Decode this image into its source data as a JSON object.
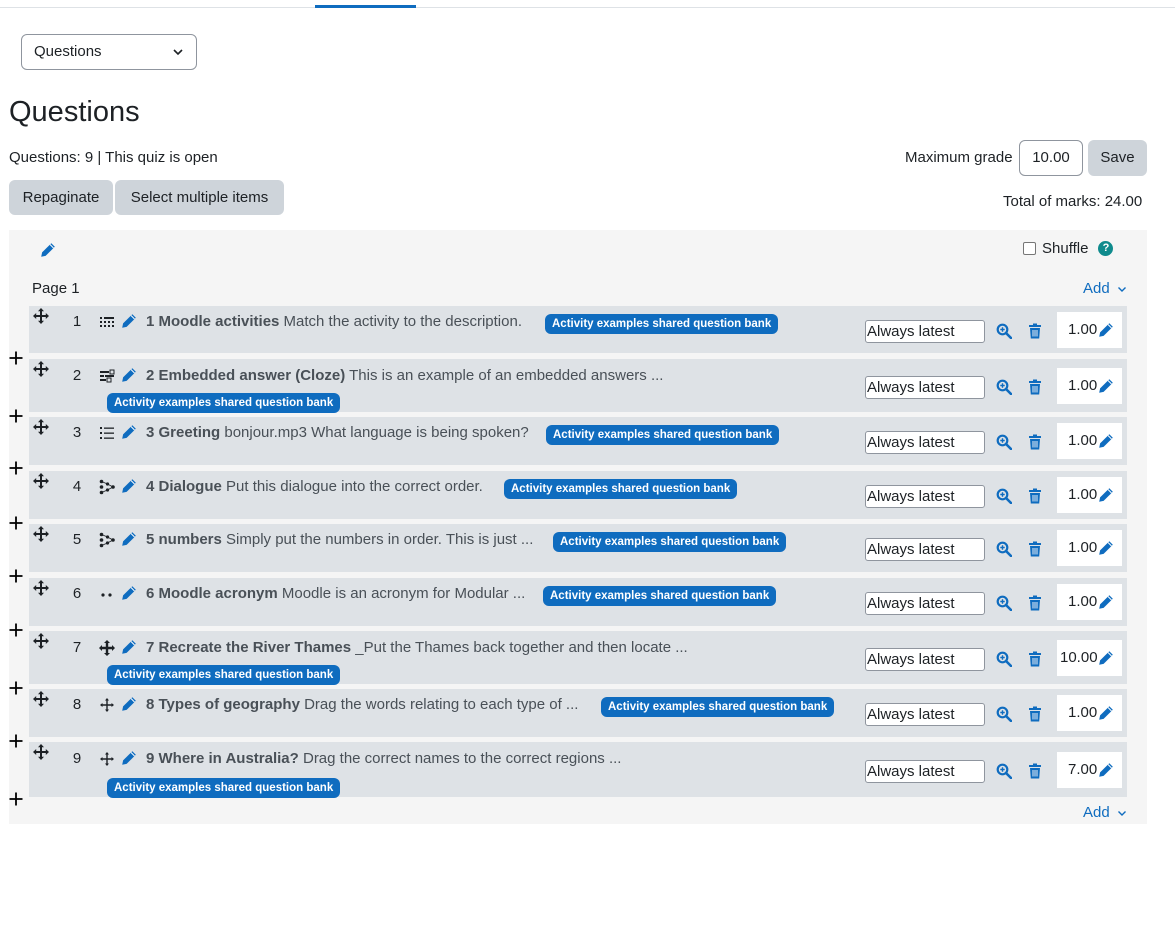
{
  "nav": {
    "selected": "Questions"
  },
  "title": "Questions",
  "info": "Questions: 9 | This quiz is open",
  "max_grade": {
    "label": "Maximum grade",
    "value": "10.00",
    "save_label": "Save"
  },
  "toolbar": {
    "repaginate_label": "Repaginate",
    "select_multiple_label": "Select multiple items"
  },
  "total_marks": "Total of marks: 24.00",
  "section": {
    "shuffle_label": "Shuffle",
    "help": "?",
    "page_label": "Page 1",
    "add_label": "Add"
  },
  "colors": {
    "accent": "#0f6cbf",
    "slot_bg": "#dee2e6",
    "button_grey": "#ced4da",
    "help_teal": "#0f8b8d"
  },
  "questions": [
    {
      "num": "1",
      "icon": "match-icon",
      "name": "1 Moodle activities",
      "text": "Match the activity to the description.",
      "bank": "Activity examples shared question bank",
      "version": "Always latest",
      "mark": "1.00"
    },
    {
      "num": "2",
      "icon": "cloze-icon",
      "name": "2 Embedded answer (Cloze)",
      "text": "This is an example of an embedded answers ...",
      "bank": "Activity examples shared question bank",
      "version": "Always latest",
      "mark": "1.00"
    },
    {
      "num": "3",
      "icon": "multichoice-icon",
      "name": "3 Greeting",
      "text": "bonjour.mp3 What language is being spoken?",
      "bank": "Activity examples shared question bank",
      "version": "Always latest",
      "mark": "1.00"
    },
    {
      "num": "4",
      "icon": "ordering-icon",
      "name": "4 Dialogue",
      "text": "Put this dialogue into the correct order.",
      "bank": "Activity examples shared question bank",
      "version": "Always latest",
      "mark": "1.00"
    },
    {
      "num": "5",
      "icon": "ordering-icon",
      "name": "5 numbers",
      "text": "Simply put the numbers in order. This is just ...",
      "bank": "Activity examples shared question bank",
      "version": "Always latest",
      "mark": "1.00"
    },
    {
      "num": "6",
      "icon": "shortanswer-icon",
      "name": "6 Moodle acronym",
      "text": "Moodle is an acronym for Modular ...",
      "bank": "Activity examples shared question bank",
      "version": "Always latest",
      "mark": "1.00"
    },
    {
      "num": "7",
      "icon": "ddmarker-icon",
      "name": "7 Recreate the River Thames",
      "text": "_Put the Thames back together and then locate ...",
      "bank": "Activity examples shared question bank",
      "version": "Always latest",
      "mark": "10.00"
    },
    {
      "num": "8",
      "icon": "ddwtos-icon",
      "name": "8 Types of geography",
      "text": "Drag the words relating to each type of ...",
      "bank": "Activity examples shared question bank",
      "version": "Always latest",
      "mark": "1.00"
    },
    {
      "num": "9",
      "icon": "ddimageortext-icon",
      "name": "9 Where in Australia?",
      "text": "Drag the correct names to the correct regions ...",
      "bank": "Activity examples shared question bank",
      "version": "Always latest",
      "mark": "7.00"
    }
  ]
}
